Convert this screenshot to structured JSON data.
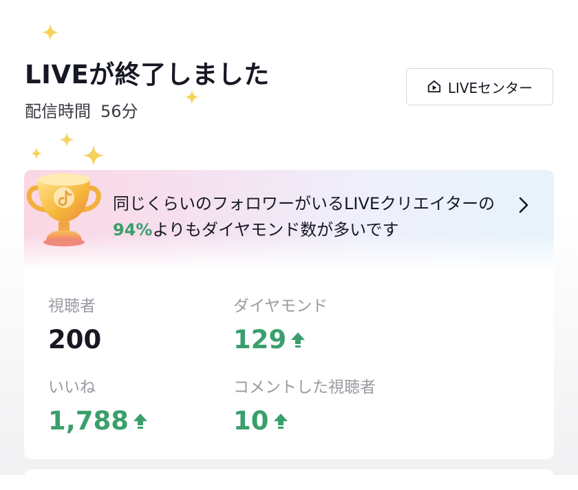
{
  "header": {
    "title": "LIVEが終了しました",
    "duration_label": "配信時間",
    "duration_value": "56分",
    "live_center_button": "LIVEセンター",
    "live_center_icon": "home-play-icon"
  },
  "banner": {
    "text_before": "同じくらいのフォロワーがいるLIVEクリエイターの",
    "percent": "94%",
    "text_after": "よりもダイヤモンド数が多いです",
    "icon": "trophy-icon"
  },
  "stats": [
    {
      "label": "視聴者",
      "value": "200",
      "increase": false
    },
    {
      "label": "ダイヤモンド",
      "value": "129",
      "increase": true
    },
    {
      "label": "いいね",
      "value": "1,788",
      "increase": true
    },
    {
      "label": "コメントした視聴者",
      "value": "10",
      "increase": true
    }
  ],
  "colors": {
    "accent_green": "#3a9f6c",
    "sparkle_gold": "#f5d35a",
    "text_primary": "#161823",
    "text_secondary": "#9a9aa2"
  }
}
